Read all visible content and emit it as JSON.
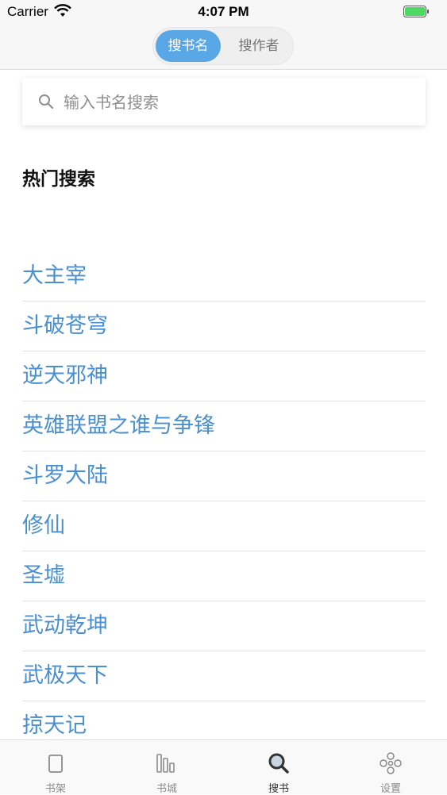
{
  "status_bar": {
    "carrier": "Carrier",
    "time": "4:07 PM",
    "battery_level": 1.0,
    "wifi_icon": "wifi-icon",
    "battery_icon": "battery-icon"
  },
  "segment": {
    "options": [
      "搜书名",
      "搜作者"
    ],
    "selected": "搜书名"
  },
  "search": {
    "placeholder": "输入书名搜索",
    "value": "",
    "icon": "search-icon"
  },
  "hot_section": {
    "title": "热门搜索",
    "items": [
      "大主宰",
      "斗破苍穹",
      "逆天邪神",
      "英雄联盟之谁与争锋",
      "斗罗大陆",
      "修仙",
      "圣墟",
      "武动乾坤",
      "武极天下",
      "掠天记"
    ]
  },
  "tab_bar": {
    "tabs": [
      {
        "label": "书架",
        "icon": "bookshelf-icon"
      },
      {
        "label": "书城",
        "icon": "bookstore-icon"
      },
      {
        "label": "搜书",
        "icon": "search-icon"
      },
      {
        "label": "设置",
        "icon": "settings-icon"
      }
    ],
    "selected": "搜书"
  },
  "colors": {
    "accent": "#5aa7e6",
    "link_text": "#4a90d0",
    "battery": "#4cd964"
  }
}
